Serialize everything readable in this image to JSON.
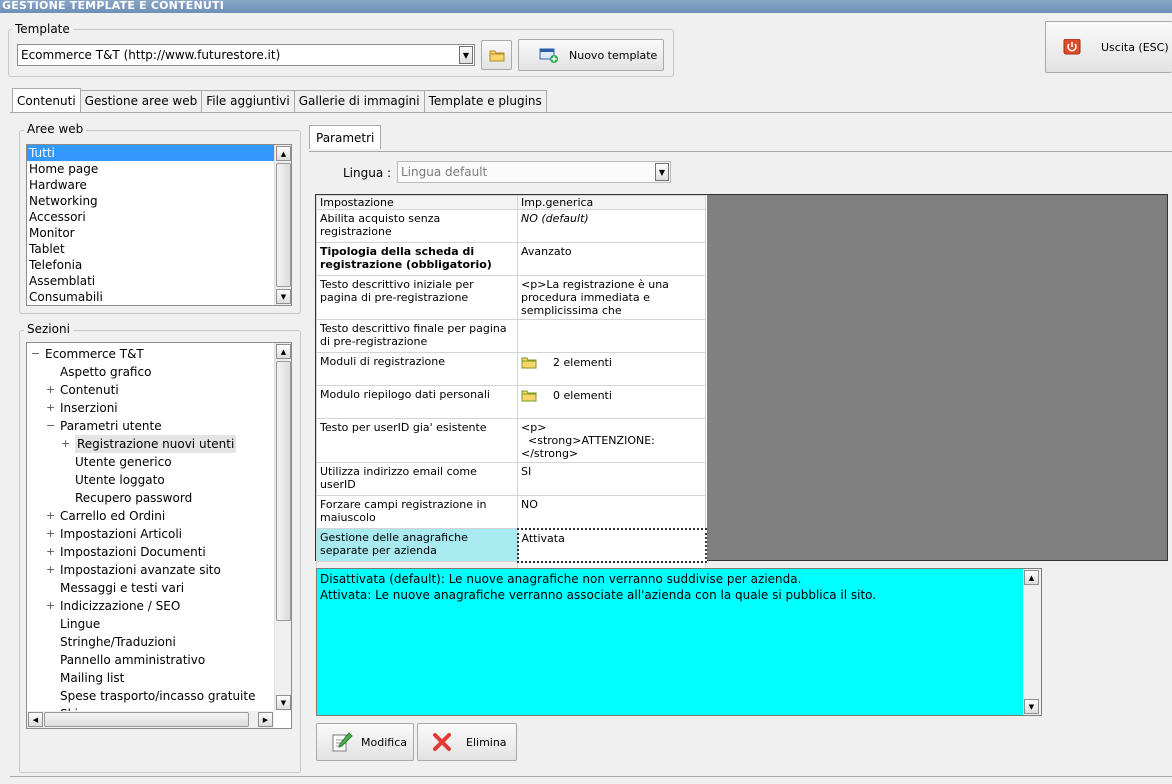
{
  "window": {
    "title": "GESTIONE TEMPLATE E CONTENUTI"
  },
  "template": {
    "group_label": "Template",
    "selected": "Ecommerce T&T (http://www.futurestore.it)",
    "new_template_label": "Nuovo template",
    "exit_label": "Uscita (ESC)"
  },
  "tabs": [
    "Contenuti",
    "Gestione aree web",
    "File aggiuntivi",
    "Gallerie di immagini",
    "Template e plugins"
  ],
  "aree_web": {
    "label": "Aree web",
    "items": [
      "Tutti",
      "Home page",
      "Hardware",
      "Networking",
      "Accessori",
      "Monitor",
      "Tablet",
      "Telefonia",
      "Assemblati",
      "Consumabili"
    ]
  },
  "sezioni": {
    "label": "Sezioni",
    "nodes": [
      {
        "text": "Ecommerce T&T",
        "level": 0,
        "exp": "minus"
      },
      {
        "text": "Aspetto grafico",
        "level": 1,
        "exp": ""
      },
      {
        "text": "Contenuti",
        "level": 1,
        "exp": "plus"
      },
      {
        "text": "Inserzioni",
        "level": 1,
        "exp": "plus"
      },
      {
        "text": "Parametri utente",
        "level": 1,
        "exp": "minus"
      },
      {
        "text": "Registrazione nuovi utenti",
        "level": 2,
        "exp": "plus",
        "selected": true
      },
      {
        "text": "Utente generico",
        "level": 2,
        "exp": ""
      },
      {
        "text": "Utente loggato",
        "level": 2,
        "exp": ""
      },
      {
        "text": "Recupero password",
        "level": 2,
        "exp": ""
      },
      {
        "text": "Carrello ed Ordini",
        "level": 1,
        "exp": "plus"
      },
      {
        "text": "Impostazioni Articoli",
        "level": 1,
        "exp": "plus"
      },
      {
        "text": "Impostazioni Documenti",
        "level": 1,
        "exp": "plus"
      },
      {
        "text": "Impostazioni avanzate sito",
        "level": 1,
        "exp": "plus"
      },
      {
        "text": "Messaggi e testi vari",
        "level": 1,
        "exp": ""
      },
      {
        "text": "Indicizzazione / SEO",
        "level": 1,
        "exp": "plus"
      },
      {
        "text": "Lingue",
        "level": 1,
        "exp": ""
      },
      {
        "text": "Stringhe/Traduzioni",
        "level": 1,
        "exp": ""
      },
      {
        "text": "Pannello amministrativo",
        "level": 1,
        "exp": ""
      },
      {
        "text": "Mailing list",
        "level": 1,
        "exp": ""
      },
      {
        "text": "Spese trasporto/incasso gratuite",
        "level": 1,
        "exp": ""
      },
      {
        "text": "Skins",
        "level": 1,
        "exp": ""
      }
    ]
  },
  "parametri": {
    "tab_label": "Parametri",
    "lingua_label": "Lingua :",
    "lingua_value": "Lingua default",
    "headers": [
      "Impostazione",
      "Imp.generica"
    ],
    "rows": [
      {
        "name": "Abilita acquisto senza registrazione",
        "value": "NO (default)",
        "italic": true
      },
      {
        "name": "Tipologia della scheda di registrazione (obbligatorio)",
        "value": "Avanzato",
        "bold": true
      },
      {
        "name": "Testo descrittivo iniziale per pagina di pre-registrazione",
        "value": "<p>La registrazione è una procedura immediata e semplicissima che"
      },
      {
        "name": "Testo descrittivo finale per pagina di pre-registrazione",
        "value": ""
      },
      {
        "name": "Moduli di registrazione",
        "value": "2 elementi",
        "icon": "folder-icon"
      },
      {
        "name": "Modulo riepilogo dati personali",
        "value": "0 elementi",
        "icon": "folder-icon"
      },
      {
        "name": "Testo per userID gia' esistente",
        "value": "<p>\n  <strong>ATTENZIONE:</strong>"
      },
      {
        "name": "Utilizza indirizzo email come userID",
        "value": "SI"
      },
      {
        "name": "Forzare campi registrazione in maiuscolo",
        "value": "NO"
      },
      {
        "name": "Gestione delle anagrafiche separate per azienda",
        "value": "Attivata",
        "selected": true
      }
    ],
    "description": [
      "Disattivata (default): Le nuove anagrafiche non verranno suddivise per azienda.",
      "Attivata: Le nuove anagrafiche verranno associate all'azienda con la quale si pubblica il sito."
    ],
    "modifica_label": "Modifica",
    "elimina_label": "Elimina"
  },
  "colors": {
    "selection": "#3399ff",
    "description_bg": "#00ffff",
    "selected_cell": "#a8eaf0"
  }
}
